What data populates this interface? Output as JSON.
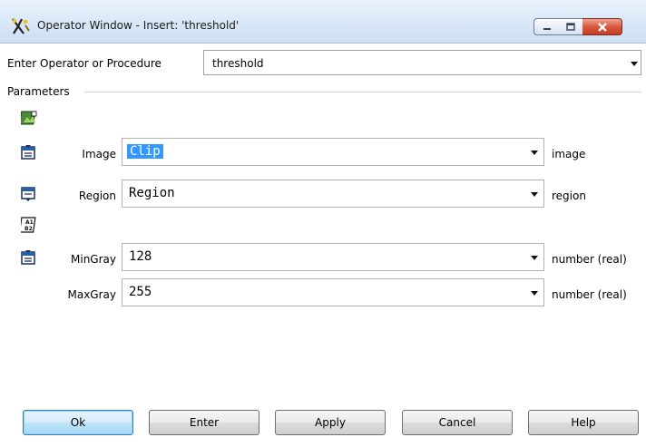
{
  "window": {
    "title": "Operator Window - Insert: 'threshold'",
    "controls": {
      "minimize_icon": "minimize-icon",
      "maximize_icon": "maximize-icon",
      "close_icon": "close-icon"
    }
  },
  "operator": {
    "label": "Enter Operator or Procedure",
    "value": "threshold"
  },
  "parameters": {
    "group_title": "Parameters",
    "rows": [
      {
        "label": "Image",
        "value": "Clip",
        "type": "image",
        "icon": "input-iconic-icon",
        "selected": true
      },
      {
        "label": "Region",
        "value": "Region",
        "type": "region",
        "icon": "output-iconic-icon"
      },
      {
        "label": "MinGray",
        "value": "128",
        "type": "number (real)",
        "icon": "input-control-icon"
      },
      {
        "label": "MaxGray",
        "value": "255",
        "type": "number (real)",
        "icon": ""
      }
    ]
  },
  "buttons": {
    "ok": "Ok",
    "enter": "Enter",
    "apply": "Apply",
    "cancel": "Cancel",
    "help": "Help"
  },
  "colors": {
    "selection": "#3399ff",
    "close_button": "#c9452b",
    "default_button": "#a7d9f5"
  }
}
